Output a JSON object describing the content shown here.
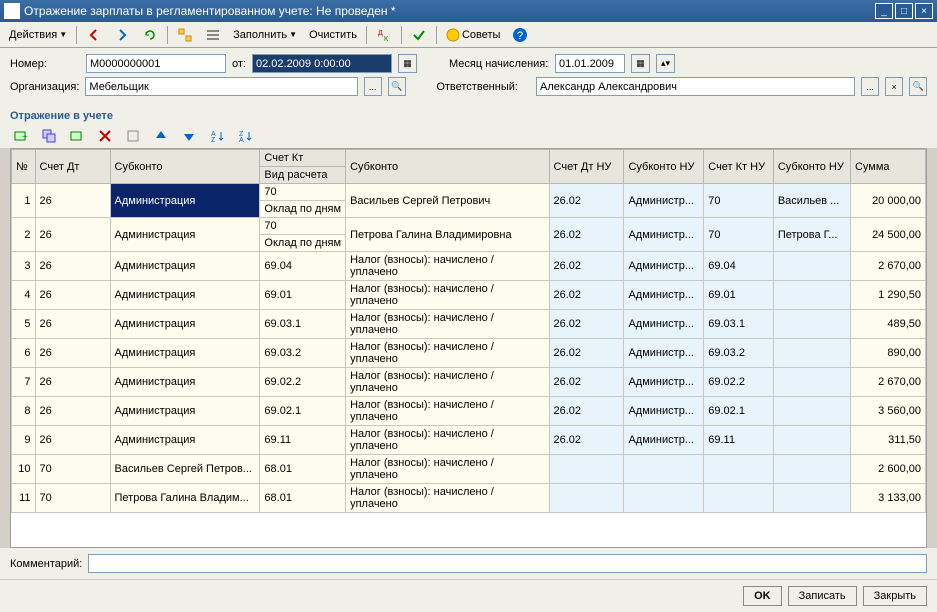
{
  "window": {
    "title": "Отражение зарплаты в регламентированном учете: Не проведен *"
  },
  "toolbar": {
    "actions": "Действия",
    "fill": "Заполнить",
    "clear": "Очистить",
    "tips": "Советы"
  },
  "form": {
    "number_label": "Номер:",
    "number_value": "М0000000001",
    "from_label": "от:",
    "from_value": "02.02.2009 0:00:00",
    "month_label": "Месяц начисления:",
    "month_value": "01.01.2009",
    "org_label": "Организация:",
    "org_value": "Мебельщик",
    "resp_label": "Ответственный:",
    "resp_value": "Александр Александрович"
  },
  "section": {
    "title": "Отражение в учете"
  },
  "table": {
    "headers": {
      "num": "№",
      "dt": "Счет Дт",
      "sub": "Субконто",
      "kt": "Счет Кт",
      "calc": "Вид расчета",
      "sub2": "Субконто",
      "dtnu": "Счет Дт НУ",
      "subnu": "Субконто НУ",
      "ktnu": "Счет Кт НУ",
      "subnu2": "Субконто НУ",
      "sum": "Сумма"
    },
    "rows": [
      {
        "n": "1",
        "dt": "26",
        "sub": "Администрация",
        "kt": "70",
        "calc": "Оклад по дням",
        "sub2": "Васильев Сергей Петрович",
        "dtnu": "26.02",
        "subnu": "Администр...",
        "ktnu": "70",
        "subnu2": "Васильев ...",
        "sum": "20 000,00"
      },
      {
        "n": "2",
        "dt": "26",
        "sub": "Администрация",
        "kt": "70",
        "calc": "Оклад по дням",
        "sub2": "Петрова Галина Владимировна",
        "dtnu": "26.02",
        "subnu": "Администр...",
        "ktnu": "70",
        "subnu2": "Петрова Г...",
        "sum": "24 500,00"
      },
      {
        "n": "3",
        "dt": "26",
        "sub": "Администрация",
        "kt": "69.04",
        "calc": "",
        "sub2": "Налог (взносы): начислено / уплачено",
        "dtnu": "26.02",
        "subnu": "Администр...",
        "ktnu": "69.04",
        "subnu2": "",
        "sum": "2 670,00"
      },
      {
        "n": "4",
        "dt": "26",
        "sub": "Администрация",
        "kt": "69.01",
        "calc": "",
        "sub2": "Налог (взносы): начислено / уплачено",
        "dtnu": "26.02",
        "subnu": "Администр...",
        "ktnu": "69.01",
        "subnu2": "",
        "sum": "1 290,50"
      },
      {
        "n": "5",
        "dt": "26",
        "sub": "Администрация",
        "kt": "69.03.1",
        "calc": "",
        "sub2": "Налог (взносы): начислено / уплачено",
        "dtnu": "26.02",
        "subnu": "Администр...",
        "ktnu": "69.03.1",
        "subnu2": "",
        "sum": "489,50"
      },
      {
        "n": "6",
        "dt": "26",
        "sub": "Администрация",
        "kt": "69.03.2",
        "calc": "",
        "sub2": "Налог (взносы): начислено / уплачено",
        "dtnu": "26.02",
        "subnu": "Администр...",
        "ktnu": "69.03.2",
        "subnu2": "",
        "sum": "890,00"
      },
      {
        "n": "7",
        "dt": "26",
        "sub": "Администрация",
        "kt": "69.02.2",
        "calc": "",
        "sub2": "Налог (взносы): начислено / уплачено",
        "dtnu": "26.02",
        "subnu": "Администр...",
        "ktnu": "69.02.2",
        "subnu2": "",
        "sum": "2 670,00"
      },
      {
        "n": "8",
        "dt": "26",
        "sub": "Администрация",
        "kt": "69.02.1",
        "calc": "",
        "sub2": "Налог (взносы): начислено / уплачено",
        "dtnu": "26.02",
        "subnu": "Администр...",
        "ktnu": "69.02.1",
        "subnu2": "",
        "sum": "3 560,00"
      },
      {
        "n": "9",
        "dt": "26",
        "sub": "Администрация",
        "kt": "69.11",
        "calc": "",
        "sub2": "Налог (взносы): начислено / уплачено",
        "dtnu": "26.02",
        "subnu": "Администр...",
        "ktnu": "69.11",
        "subnu2": "",
        "sum": "311,50"
      },
      {
        "n": "10",
        "dt": "70",
        "sub": "Васильев Сергей Петров...",
        "kt": "68.01",
        "calc": "",
        "sub2": "Налог (взносы): начислено / уплачено",
        "dtnu": "",
        "subnu": "",
        "ktnu": "",
        "subnu2": "",
        "sum": "2 600,00"
      },
      {
        "n": "11",
        "dt": "70",
        "sub": "Петрова Галина Владим...",
        "kt": "68.01",
        "calc": "",
        "sub2": "Налог (взносы): начислено / уплачено",
        "dtnu": "",
        "subnu": "",
        "ktnu": "",
        "subnu2": "",
        "sum": "3 133,00"
      }
    ]
  },
  "footer": {
    "comment_label": "Комментарий:",
    "comment_value": "",
    "ok": "OK",
    "save": "Записать",
    "close": "Закрыть"
  }
}
